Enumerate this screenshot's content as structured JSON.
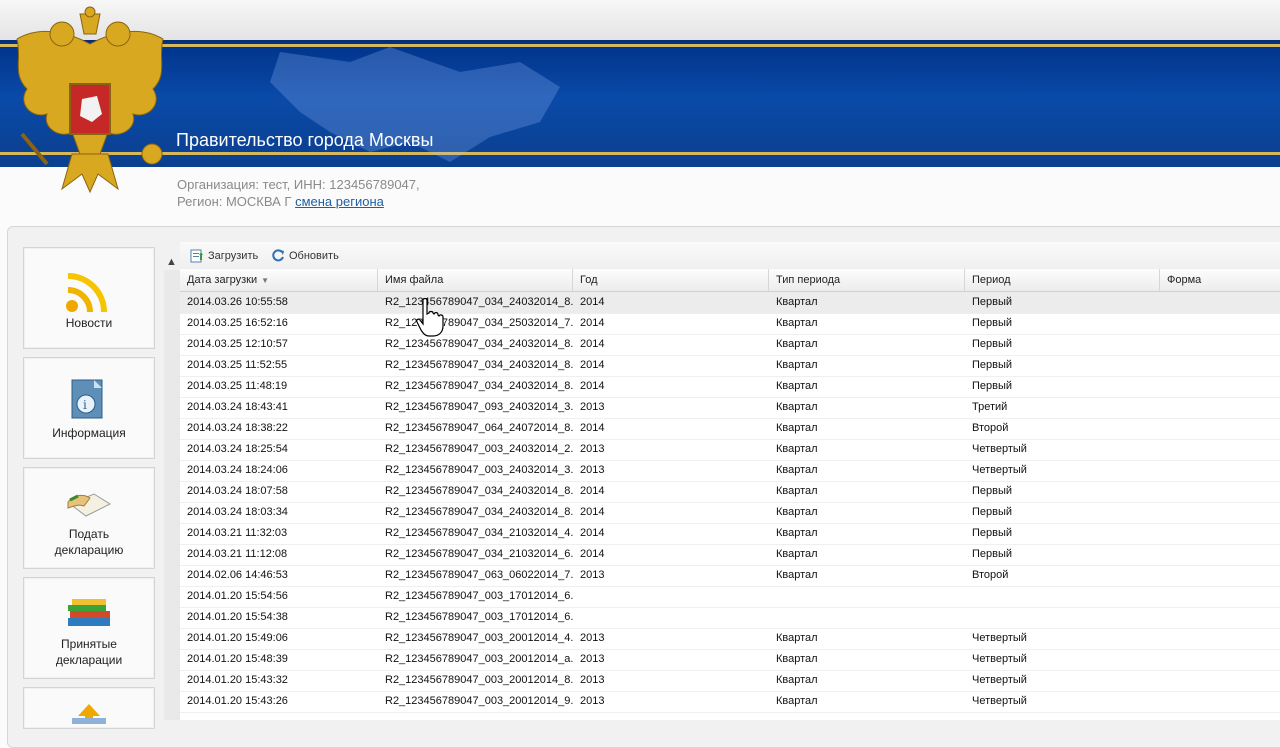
{
  "banner": {
    "title": "Правительство города Москвы"
  },
  "org": {
    "line1": "Организация: тест, ИНН: 123456789047,",
    "region_prefix": "Регион: МОСКВА Г",
    "change_region": "смена региона"
  },
  "nav": [
    {
      "label": "Новости",
      "icon": "rss-icon"
    },
    {
      "label": "Информация",
      "icon": "info-document-icon"
    },
    {
      "label_line1": "Подать",
      "label_line2": "декларацию",
      "icon": "submit-document-icon"
    },
    {
      "label_line1": "Принятые",
      "label_line2": "декларации",
      "icon": "books-icon"
    },
    {
      "label": "",
      "icon": "upload-icon"
    }
  ],
  "toolbar": {
    "upload": "Загрузить",
    "refresh": "Обновить"
  },
  "columns": [
    "Дата загрузки",
    "Имя файла",
    "Год",
    "Тип периода",
    "Период",
    "Форма"
  ],
  "rows": [
    [
      "2014.03.26 10:55:58",
      "R2_123456789047_034_24032014_8...",
      "2014",
      "Квартал",
      "Первый",
      ""
    ],
    [
      "2014.03.25 16:52:16",
      "R2_123456789047_034_25032014_7...",
      "2014",
      "Квартал",
      "Первый",
      ""
    ],
    [
      "2014.03.25 12:10:57",
      "R2_123456789047_034_24032014_8...",
      "2014",
      "Квартал",
      "Первый",
      ""
    ],
    [
      "2014.03.25 11:52:55",
      "R2_123456789047_034_24032014_8...",
      "2014",
      "Квартал",
      "Первый",
      ""
    ],
    [
      "2014.03.25 11:48:19",
      "R2_123456789047_034_24032014_8...",
      "2014",
      "Квартал",
      "Первый",
      ""
    ],
    [
      "2014.03.24 18:43:41",
      "R2_123456789047_093_24032014_3...",
      "2013",
      "Квартал",
      "Третий",
      ""
    ],
    [
      "2014.03.24 18:38:22",
      "R2_123456789047_064_24072014_8...",
      "2014",
      "Квартал",
      "Второй",
      ""
    ],
    [
      "2014.03.24 18:25:54",
      "R2_123456789047_003_24032014_2...",
      "2013",
      "Квартал",
      "Четвертый",
      ""
    ],
    [
      "2014.03.24 18:24:06",
      "R2_123456789047_003_24032014_3...",
      "2013",
      "Квартал",
      "Четвертый",
      ""
    ],
    [
      "2014.03.24 18:07:58",
      "R2_123456789047_034_24032014_8...",
      "2014",
      "Квартал",
      "Первый",
      ""
    ],
    [
      "2014.03.24 18:03:34",
      "R2_123456789047_034_24032014_8...",
      "2014",
      "Квартал",
      "Первый",
      ""
    ],
    [
      "2014.03.21 11:32:03",
      "R2_123456789047_034_21032014_4...",
      "2014",
      "Квартал",
      "Первый",
      ""
    ],
    [
      "2014.03.21 11:12:08",
      "R2_123456789047_034_21032014_6...",
      "2014",
      "Квартал",
      "Первый",
      ""
    ],
    [
      "2014.02.06 14:46:53",
      "R2_123456789047_063_06022014_7...",
      "2013",
      "Квартал",
      "Второй",
      ""
    ],
    [
      "2014.01.20 15:54:56",
      "R2_123456789047_003_17012014_6...",
      "",
      "",
      "",
      ""
    ],
    [
      "2014.01.20 15:54:38",
      "R2_123456789047_003_17012014_6...",
      "",
      "",
      "",
      ""
    ],
    [
      "2014.01.20 15:49:06",
      "R2_123456789047_003_20012014_4...",
      "2013",
      "Квартал",
      "Четвертый",
      ""
    ],
    [
      "2014.01.20 15:48:39",
      "R2_123456789047_003_20012014_a...",
      "2013",
      "Квартал",
      "Четвертый",
      ""
    ],
    [
      "2014.01.20 15:43:32",
      "R2_123456789047_003_20012014_8...",
      "2013",
      "Квартал",
      "Четвертый",
      ""
    ],
    [
      "2014.01.20 15:43:26",
      "R2_123456789047_003_20012014_9...",
      "2013",
      "Квартал",
      "Четвертый",
      ""
    ]
  ],
  "selected_row": 0,
  "colors": {
    "banner_blue": "#0a4aa8",
    "gold": "#d7b75c",
    "link": "#1f5fa5"
  }
}
